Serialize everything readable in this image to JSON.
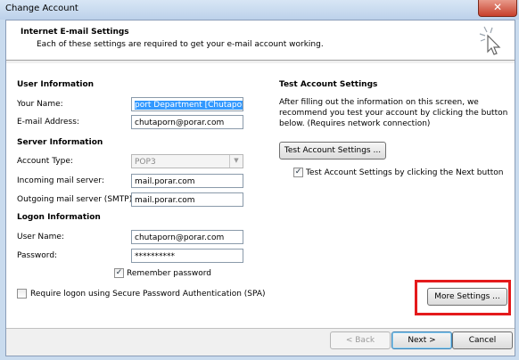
{
  "window": {
    "title": "Change Account",
    "close_glyph": "✕"
  },
  "header": {
    "title": "Internet E-mail Settings",
    "subtitle": "Each of these settings are required to get your e-mail account working.",
    "icon": "cursor-sparkle-icon"
  },
  "user_info": {
    "section": "User Information",
    "name_label": "Your Name:",
    "name_value": "port Department [Chutaporn]",
    "email_label": "E-mail Address:",
    "email_value": "chutaporn@porar.com"
  },
  "server_info": {
    "section": "Server Information",
    "account_type_label": "Account Type:",
    "account_type_value": "POP3",
    "incoming_label": "Incoming mail server:",
    "incoming_value": "mail.porar.com",
    "outgoing_label": "Outgoing mail server (SMTP):",
    "outgoing_value": "mail.porar.com"
  },
  "logon_info": {
    "section": "Logon Information",
    "username_label": "User Name:",
    "username_value": "chutaporn@porar.com",
    "password_label": "Password:",
    "password_value": "**********",
    "remember_label": "Remember password",
    "remember_checked": true,
    "spa_label": "Require logon using Secure Password Authentication (SPA)",
    "spa_checked": false
  },
  "test_settings": {
    "section": "Test Account Settings",
    "description_lines": [
      "After filling out the information on this screen, we",
      "recommend you test your account by clicking the button",
      "below. (Requires network connection)"
    ],
    "test_button": "Test Account Settings ...",
    "auto_test_label": "Test Account Settings by clicking the Next button",
    "auto_test_checked": true
  },
  "more_settings_button": "More Settings ...",
  "footer": {
    "back_button": "< Back",
    "next_button": "Next >",
    "cancel_button": "Cancel"
  },
  "colors": {
    "highlight_box": "#e41a1c",
    "selection": "#3399ff"
  }
}
